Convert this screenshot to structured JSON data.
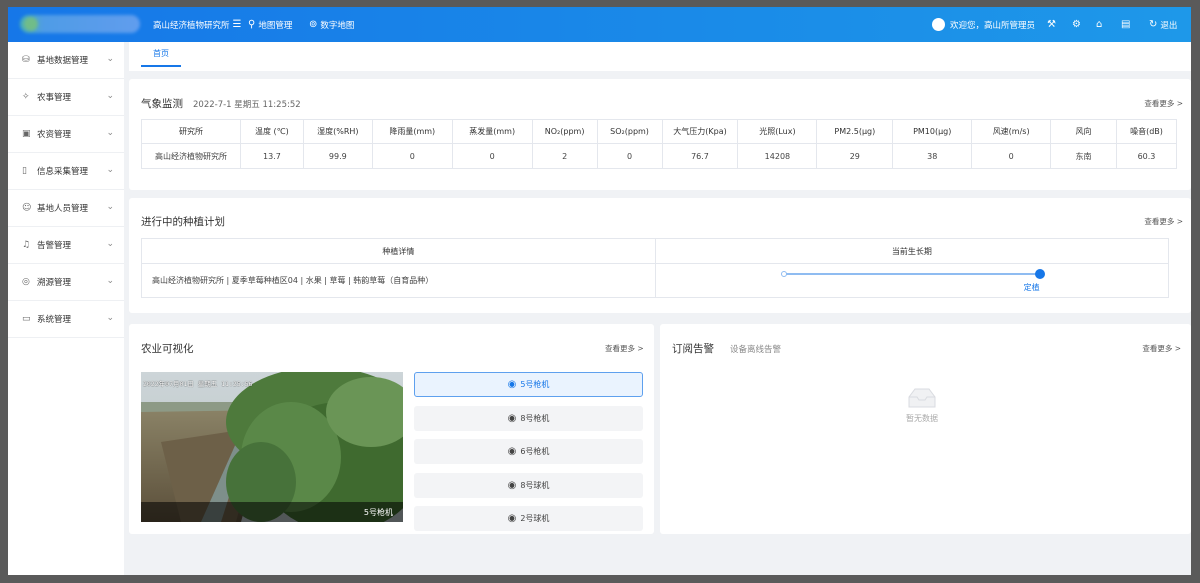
{
  "topbar": {
    "org_menu": "高山经济植物研究所",
    "menu_icon": "list-menu-icon",
    "nav": [
      "地图管理",
      "数字地图"
    ],
    "welcome": "欢迎您，高山所管理员",
    "logout": "退出"
  },
  "sidebar": {
    "items": [
      {
        "label": "基地数据管理",
        "icon": "database-icon"
      },
      {
        "label": "农事管理",
        "icon": "farming-icon"
      },
      {
        "label": "农资管理",
        "icon": "box-icon"
      },
      {
        "label": "信息采集管理",
        "icon": "document-icon"
      },
      {
        "label": "基地人员管理",
        "icon": "user-icon"
      },
      {
        "label": "告警管理",
        "icon": "bell-icon"
      },
      {
        "label": "溯源管理",
        "icon": "target-icon"
      },
      {
        "label": "系统管理",
        "icon": "chat-icon"
      }
    ]
  },
  "tabs": {
    "home": "首页"
  },
  "weather": {
    "title": "气象监测",
    "datetime": "2022-7-1 星期五 11:25:52",
    "more": "查看更多 >",
    "headers": [
      "研究所",
      "温度 (℃)",
      "湿度(%RH)",
      "降雨量(mm)",
      "蒸发量(mm)",
      "NO₂(ppm)",
      "SO₂(ppm)",
      "大气压力(Kpa)",
      "光照(Lux)",
      "PM2.5(μg)",
      "PM10(μg)",
      "风速(m/s)",
      "风向",
      "噪音(dB)"
    ],
    "row": [
      "高山经济植物研究所",
      "13.7",
      "99.9",
      "0",
      "0",
      "2",
      "0",
      "76.7",
      "14208",
      "29",
      "38",
      "0",
      "东南",
      "60.3"
    ]
  },
  "plan": {
    "title": "进行中的种植计划",
    "more": "查看更多 >",
    "col_detail": "种植详情",
    "col_stage": "当前生长期",
    "detail": "高山经济植物研究所 | 夏季草莓种植区04 | 水果 | 草莓 | 韩韵草莓（自育品种）",
    "stage": "定植",
    "stage_progress": 1.0
  },
  "agri": {
    "title": "农业可视化",
    "more": "查看更多 >",
    "cam_timestamp": "2022年07月01日 星期五 11:25:56",
    "cam_label": "5号枪机",
    "cameras": [
      "5号枪机",
      "8号枪机",
      "6号枪机",
      "8号球机",
      "2号球机"
    ],
    "active_index": 0
  },
  "alarm": {
    "title": "订阅告警",
    "subtitle": "设备离线告警",
    "more": "查看更多 >",
    "empty": "暂无数据"
  },
  "colors": {
    "primary": "#1677e8",
    "sidebar_bg": "#ffffff",
    "page_bg": "#f0f2f5"
  }
}
